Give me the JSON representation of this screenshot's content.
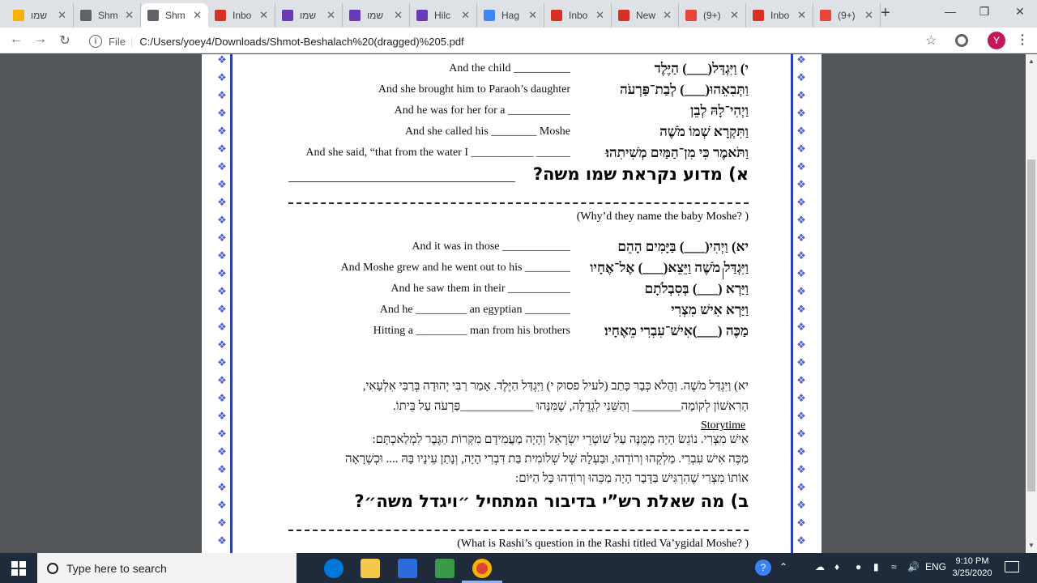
{
  "tabs": [
    {
      "title": "שמו",
      "icon": "slides-icon",
      "color": "#f4b400"
    },
    {
      "title": "Shm",
      "icon": "globe-icon",
      "color": "#5f6368"
    },
    {
      "title": "Shm",
      "icon": "globe-icon",
      "color": "#5f6368",
      "active": true
    },
    {
      "title": "Inbo",
      "icon": "gmail-icon",
      "color": "#d93025"
    },
    {
      "title": "שמו",
      "icon": "forms-icon",
      "color": "#673ab7"
    },
    {
      "title": "שמו",
      "icon": "forms-icon",
      "color": "#673ab7"
    },
    {
      "title": "Hilc",
      "icon": "forms-icon",
      "color": "#673ab7"
    },
    {
      "title": "Hag",
      "icon": "docs-icon",
      "color": "#4285f4"
    },
    {
      "title": "Inbo",
      "icon": "gmail-icon",
      "color": "#d93025"
    },
    {
      "title": "New",
      "icon": "gmail-icon",
      "color": "#d93025"
    },
    {
      "title": "(9+)",
      "icon": "pinwheel-icon",
      "color": "#e8453c"
    },
    {
      "title": "Inbo",
      "icon": "gmail-icon",
      "color": "#d93025"
    },
    {
      "title": "(9+)",
      "icon": "pinwheel-icon",
      "color": "#e8453c"
    }
  ],
  "toolbar": {
    "scheme": "File",
    "url": "C:/Users/yoey4/Downloads/Shmot-Beshalach%20(dragged)%205.pdf",
    "avatar": "Y"
  },
  "doc": {
    "lines1": [
      {
        "en": "And the child __________",
        "he": "י) וַיִּגְדַּל(___) הַיֶּלֶד"
      },
      {
        "en": "And she brought him to Paraoh’s daughter",
        "he": "וַתְּבִאֵהוּ(___) לְבַת־פַּרְעֹה"
      },
      {
        "en": "And he was for her for a ___________",
        "he": "וַיְהִי־לָהּ לְבֵן"
      },
      {
        "en": "And she called his ________  Moshe",
        "he": "וַתִּקְרָא שְׁמוֹ מֹשֶׁה"
      },
      {
        "en": "And she said, “that from the water I ___________   ______",
        "he": "וַתֹּאמֶר כִּי מִן־הַמַּיִם מְשִׁיתִהוּ׃"
      }
    ],
    "q1_he": "א) מדוע נקראת שמו משה?",
    "q1_blank": "___________________________________",
    "q1_en": "(Why’d they name the baby Moshe? )",
    "lines2": [
      {
        "en": "And it was in those ____________",
        "he": "יא) וַיְהִי(___)  בַּיָּמִים הָהֵם"
      },
      {
        "en": "And Moshe grew and he went out to his ________",
        "he": "וַיִּגְדַּל מֹשֶׁה וַיֵּצֵא(___) אֶל־אֶחָיו"
      },
      {
        "en": "And he saw them in their ___________",
        "he": "וַיַּרְא (___) בְּסִבְלֹתָם"
      },
      {
        "en": "And he _________  an egyptian ________",
        "he": "וַיַּרְא אִישׁ מִצְרִי"
      },
      {
        "en": "Hitting a _________  man from his brothers",
        "he": "מַכֶּה (___)אִישׁ־עִבְרִי מֵאֶחָיו׃"
      }
    ],
    "rashi": [
      "יא) וַיִּגְדַּל מֹשֶׁה. וַהֲלֹא כְּבָר כָּתַב (לעיל פסוק י) וַיִּגְדַּל הַיֶּלֶד. אָמַר רַבִּי יְהוּדָה בְּרַבִּי אִלְעָאִי,",
      "הָרִאשׁוֹן לְקוֹמָה________ וְהַשֵּׁנִי לִגְדֻלָּה, שֶׁמִּנָּהוּ ____________פַּרְעֹה עַל בֵּיתוֹ."
    ],
    "storytime": "Storytime",
    "rashi2": [
      "אִישׁ מִצְרִי. נוֹגֵשׂ הָיָה מְמֻנֶּה עַל שׁוֹטְרֵי יִשְׂרָאֵל וְהָיָה מַעֲמִידָם מִקְּרוֹת הַגֶּבֶר לִמְלַאכְתָּם:",
      "מַכֶּה אִישׁ עִבְרִי. מַלְקֵהוּ וְרוֹדֵהוּ, וּבַעְלָהּ שֶׁל שְׁלוֹמִית בַּת דִּבְרִי הָיָה, וְנָתַן עֵינָיו בָּהּ .... וּכְשֶׁרָאָה",
      "אוֹתוֹ מִצְרִי שֶׁהִרְגִּישׁ בַּדָּבָר הָיָה מַכֵּהוּ וְרוֹדֵהוּ כָּל הַיּוֹם:"
    ],
    "q2_he": "ב) מה שאלת רש”י בדיבור המתחיל ״ויגדל משה״?",
    "q2_en": "(What is Rashi’s question in the Rashi titled Va’ygidal Moshe? )"
  },
  "taskbar": {
    "search_placeholder": "Type here to search",
    "lang": "ENG",
    "time": "9:10 PM",
    "date": "3/25/2020"
  }
}
